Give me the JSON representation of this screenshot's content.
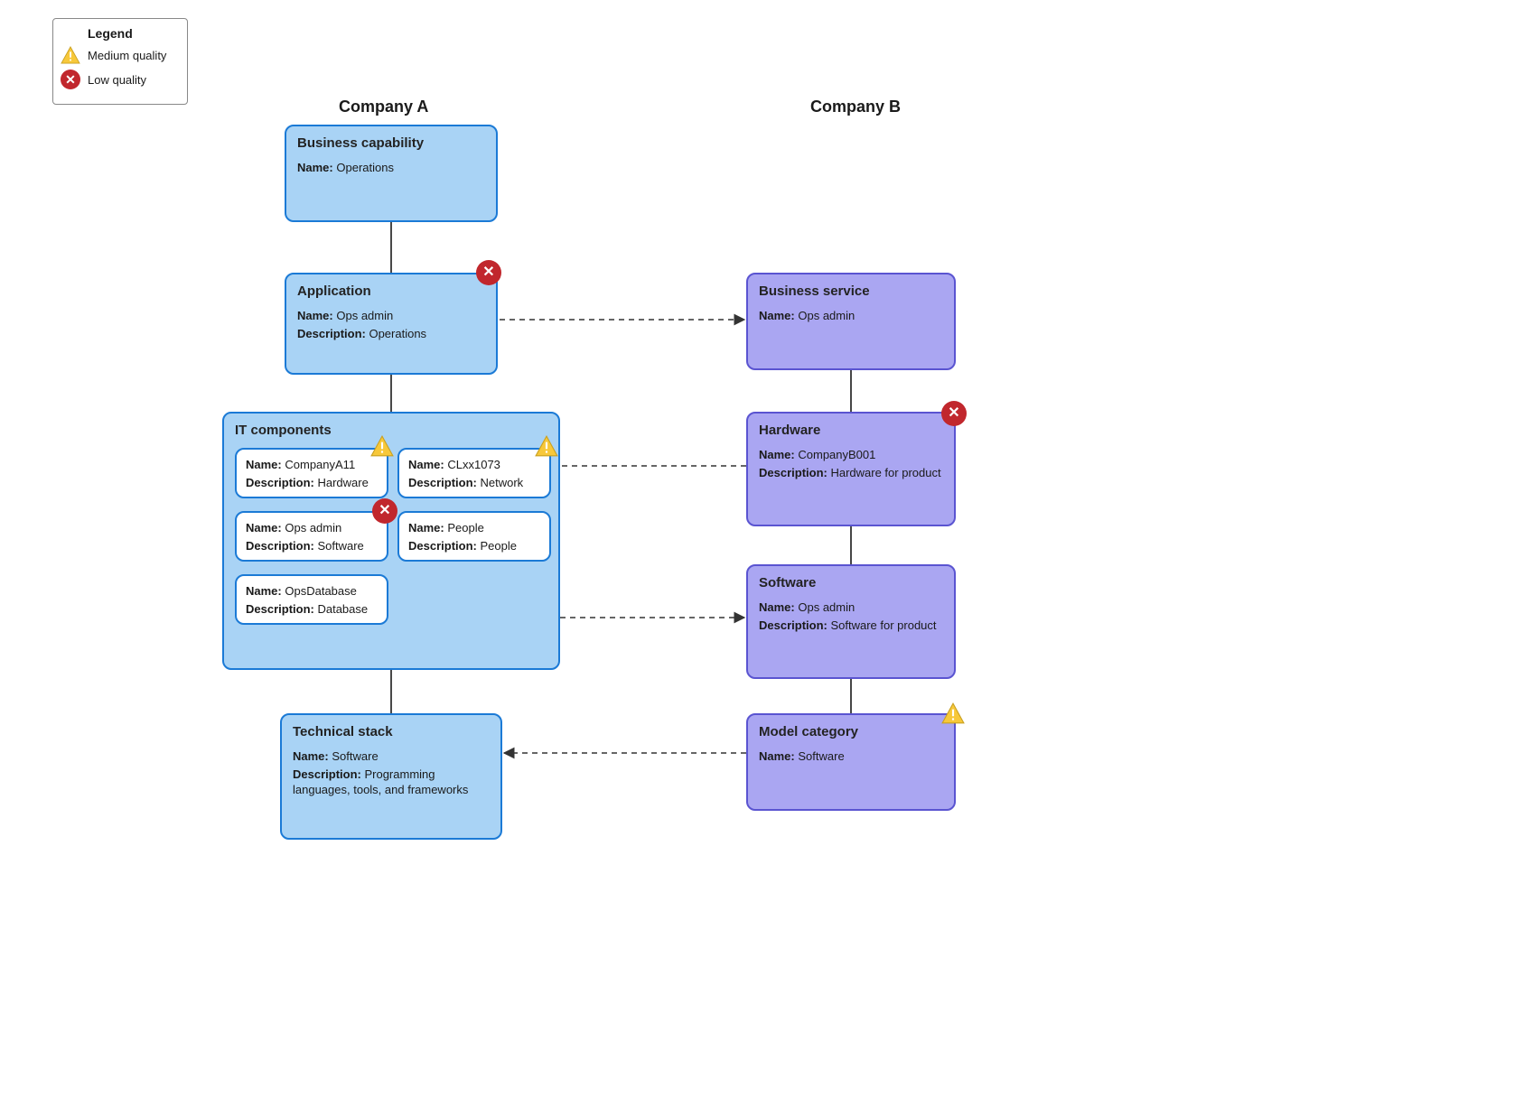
{
  "legend": {
    "title": "Legend",
    "medium": "Medium quality",
    "low": "Low quality"
  },
  "columns": {
    "a": "Company A",
    "b": "Company B"
  },
  "labels": {
    "name": "Name:",
    "desc": "Description:"
  },
  "a": {
    "cap": {
      "title": "Business capability",
      "name": "Operations"
    },
    "app": {
      "title": "Application",
      "name": "Ops admin",
      "desc": "Operations"
    },
    "itc": {
      "title": "IT components",
      "c1": {
        "name": "CompanyA11",
        "desc": "Hardware"
      },
      "c2": {
        "name": "CLxx1073",
        "desc": "Network"
      },
      "c3": {
        "name": "Ops admin",
        "desc": "Software"
      },
      "c4": {
        "name": "People",
        "desc": "People"
      },
      "c5": {
        "name": "OpsDatabase",
        "desc": "Database"
      }
    },
    "tech": {
      "title": "Technical stack",
      "name": "Software",
      "desc": "Programming languages, tools, and frameworks"
    }
  },
  "b": {
    "svc": {
      "title": "Business service",
      "name": "Ops admin"
    },
    "hw": {
      "title": "Hardware",
      "name": "CompanyB001",
      "desc": "Hardware for product"
    },
    "sw": {
      "title": "Software",
      "name": "Ops admin",
      "desc": "Software for product"
    },
    "mc": {
      "title": "Model category",
      "name": "Software"
    }
  }
}
